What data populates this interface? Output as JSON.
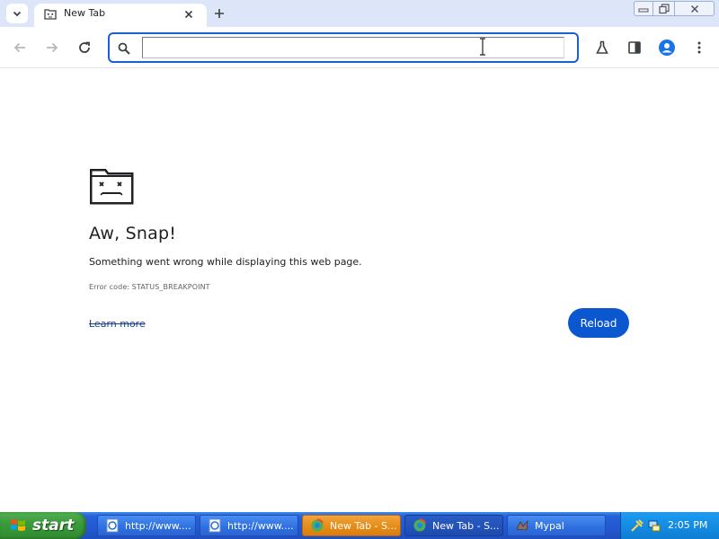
{
  "browser": {
    "tab": {
      "title": "New Tab"
    },
    "omnibox": {
      "value": "",
      "placeholder": ""
    }
  },
  "error_page": {
    "title": "Aw, Snap!",
    "message": "Something went wrong while displaying this web page.",
    "error_code": "Error code: STATUS_BREAKPOINT",
    "learn_more_label": "Learn more",
    "reload_label": "Reload"
  },
  "taskbar": {
    "start_label": "start",
    "tasks": [
      {
        "label": "http://www...."
      },
      {
        "label": "http://www...."
      },
      {
        "label": "New Tab - S..."
      },
      {
        "label": "New Tab - S..."
      },
      {
        "label": "Mypal"
      }
    ],
    "clock": "2:05 PM"
  },
  "colors": {
    "accent": "#0b57d0",
    "omnibox_border": "#1a5fd6",
    "tabstrip": "#dce6f8",
    "taskbar": "#2458d0",
    "start_button": "#3c9b3c",
    "active_task": "#e48a17"
  },
  "icons": {
    "tab_search": "chevron-down-icon",
    "favicon": "sad-tab-icon",
    "back": "arrow-left-icon",
    "forward": "arrow-right-icon",
    "reload": "reload-icon",
    "omnibox": "search-icon",
    "labs": "flask-icon",
    "side_panel": "side-panel-icon",
    "profile": "profile-icon",
    "menu": "kebab-menu-icon"
  }
}
